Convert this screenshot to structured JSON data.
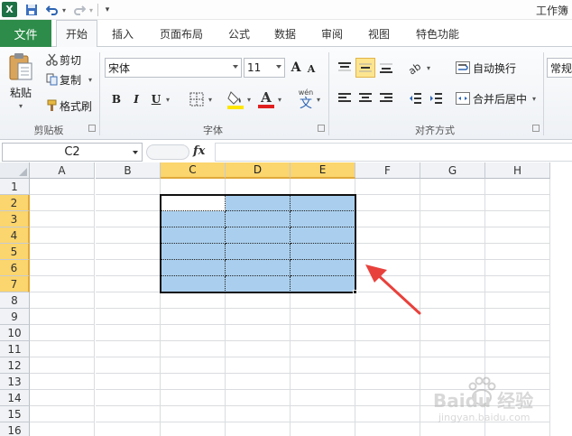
{
  "quick_access": {
    "logo": "X",
    "save_icon": "save-icon",
    "undo_icon": "undo-icon",
    "redo_icon": "redo-icon"
  },
  "title": "工作簿",
  "tabs": [
    {
      "label": "文件"
    },
    {
      "label": "开始"
    },
    {
      "label": "插入"
    },
    {
      "label": "页面布局"
    },
    {
      "label": "公式"
    },
    {
      "label": "数据"
    },
    {
      "label": "审阅"
    },
    {
      "label": "视图"
    },
    {
      "label": "特色功能"
    }
  ],
  "ribbon": {
    "clipboard": {
      "paste_label": "粘贴",
      "cut_label": "剪切",
      "copy_label": "复制",
      "format_painter_label": "格式刷",
      "group_label": "剪贴板"
    },
    "font": {
      "font_name": "宋体",
      "font_size": "11",
      "grow_font": "A",
      "shrink_font": "A",
      "bold": "B",
      "italic": "I",
      "underline": "U",
      "font_color_glyph": "A",
      "phonetic_glyph": "wén",
      "phonetic_char": "文",
      "group_label": "字体"
    },
    "alignment": {
      "wrap_text_label": "自动换行",
      "merge_center_label": "合并后居中",
      "group_label": "对齐方式"
    },
    "number": {
      "format_value": "常规"
    }
  },
  "formula_bar": {
    "name_box": "C2",
    "fx_label": "fx",
    "formula": ""
  },
  "grid": {
    "columns": [
      "A",
      "B",
      "C",
      "D",
      "E",
      "F",
      "G",
      "H"
    ],
    "rows": [
      "1",
      "2",
      "3",
      "4",
      "5",
      "6",
      "7",
      "8",
      "9",
      "10",
      "11",
      "12",
      "13",
      "14",
      "15",
      "16"
    ],
    "selected_range": "C2:E7",
    "active_cell": "C2"
  },
  "colors": {
    "file_tab": "#2d8c49",
    "selection_fill": "#aacfee",
    "header_highlight": "#fbd56d",
    "annotation_arrow": "#e8413c"
  },
  "watermark": {
    "brand": "Baidu 经验",
    "url": "jingyan.baidu.com"
  }
}
